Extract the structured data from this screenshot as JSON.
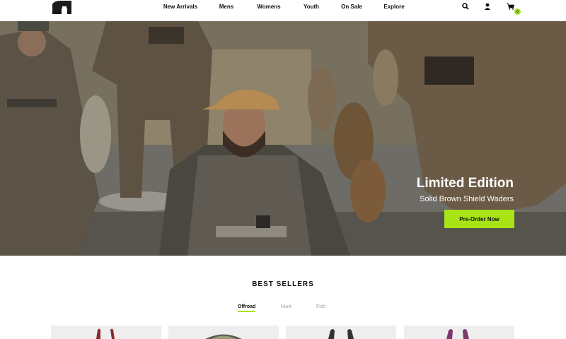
{
  "header": {
    "logo_icon": "brand-logo-icon",
    "nav": [
      "New Arrivals",
      "Mens",
      "Womens",
      "Youth",
      "On Sale",
      "Explore"
    ],
    "icons": [
      "search-icon",
      "account-icon",
      "cart-icon"
    ],
    "cart_count": "0"
  },
  "hero": {
    "title": "Limited Edition",
    "subtitle": "Solid Brown Shield Waders",
    "cta_label": "Pre-Order Now"
  },
  "best_sellers": {
    "title": "BEST SELLERS",
    "tabs": [
      "Offroad",
      "Hunt",
      "Fish"
    ],
    "active_tab": "Offroad"
  },
  "colors": {
    "accent": "#a8e416",
    "text": "#111111",
    "muted": "#9a9a9a",
    "card_bg": "#eeeeee"
  }
}
